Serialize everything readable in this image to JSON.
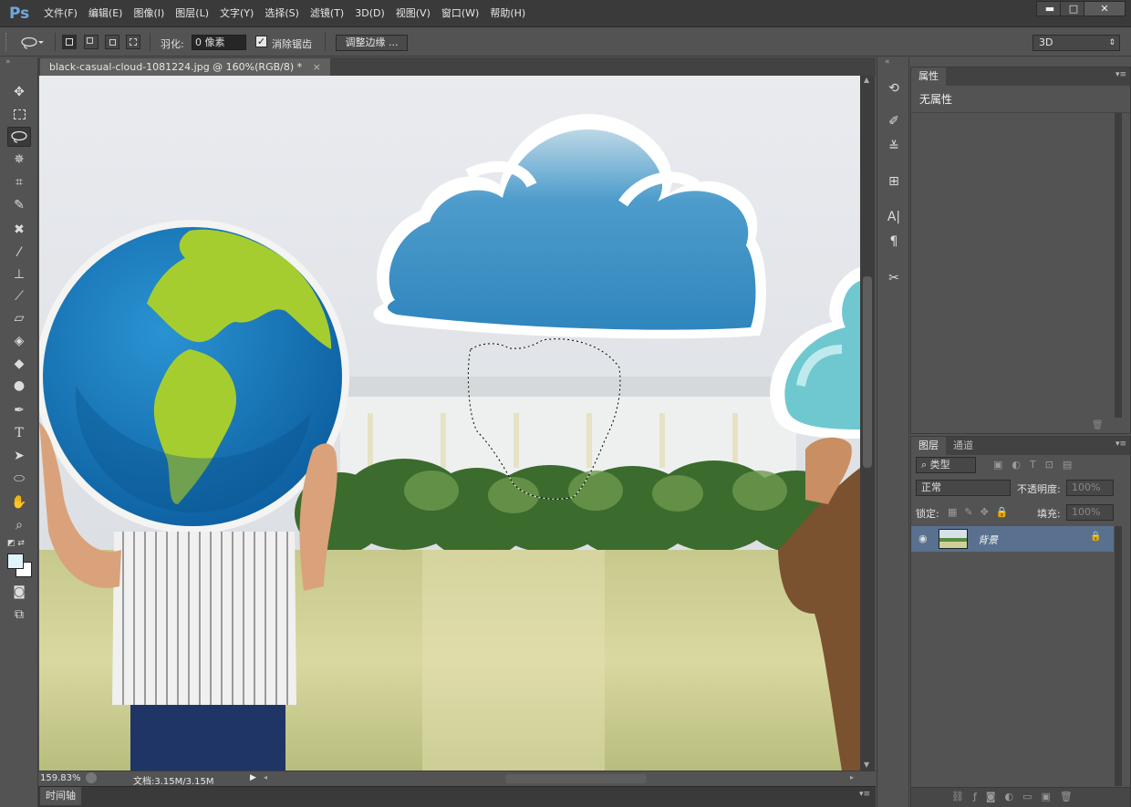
{
  "app": {
    "logo": "Ps",
    "menus": [
      "文件(F)",
      "编辑(E)",
      "图像(I)",
      "图层(L)",
      "文字(Y)",
      "选择(S)",
      "滤镜(T)",
      "3D(D)",
      "视图(V)",
      "窗口(W)",
      "帮助(H)"
    ],
    "window_controls": {
      "minimize": "▬",
      "maximize": "□",
      "close": "✕"
    }
  },
  "options": {
    "feather_label": "羽化:",
    "feather_value": "0 像素",
    "antialias_label": "消除锯齿",
    "antialias_checked": true,
    "refine_edge": "调整边缘 ...",
    "workspace": "3D"
  },
  "document": {
    "tab_title": "black-casual-cloud-1081224.jpg @ 160%(RGB/8) *",
    "zoom": "159.83%",
    "doc_size": "文档:3.15M/3.15M"
  },
  "timeline": {
    "label": "时间轴"
  },
  "properties": {
    "tab": "属性",
    "empty_text": "无属性"
  },
  "layers": {
    "tabs": [
      "图层",
      "通道"
    ],
    "filter_kind": "类型",
    "blend_mode": "正常",
    "opacity_label": "不透明度:",
    "opacity_value": "100%",
    "lock_label": "锁定:",
    "fill_label": "填充:",
    "fill_value": "100%",
    "items": [
      {
        "name": "背景",
        "visible": true,
        "locked": true
      }
    ]
  },
  "colors": {
    "accent_ps": "#6fa8dc",
    "selected_layer": "#59708f"
  }
}
